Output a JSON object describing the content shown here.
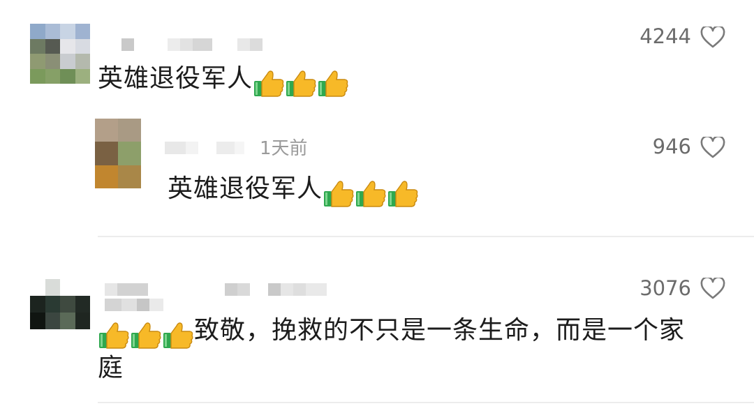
{
  "comments": [
    {
      "text": "英雄退役军人",
      "likes": "4244",
      "icons": [
        "thumbs-up-icon",
        "thumbs-up-icon",
        "thumbs-up-icon"
      ],
      "reply": {
        "time": "1天前",
        "text": "英雄退役军人",
        "likes": "946",
        "icons": [
          "thumbs-up-icon",
          "thumbs-up-icon",
          "thumbs-up-icon"
        ]
      }
    },
    {
      "text_line1": "致敬，挽救的不只是一条生命，而是一个家",
      "text_line2": "庭",
      "likes": "3076",
      "icons": [
        "thumbs-up-icon",
        "thumbs-up-icon",
        "thumbs-up-icon"
      ]
    }
  ],
  "colors": {
    "text": "#1c1c1c",
    "count": "#6b6b6b",
    "time": "#9a9a9a",
    "heart_outline": "#7a7a7a",
    "thumb_yellow": "#f7b928",
    "thumb_cuff": "#2fa84f",
    "divider": "#ececec"
  }
}
